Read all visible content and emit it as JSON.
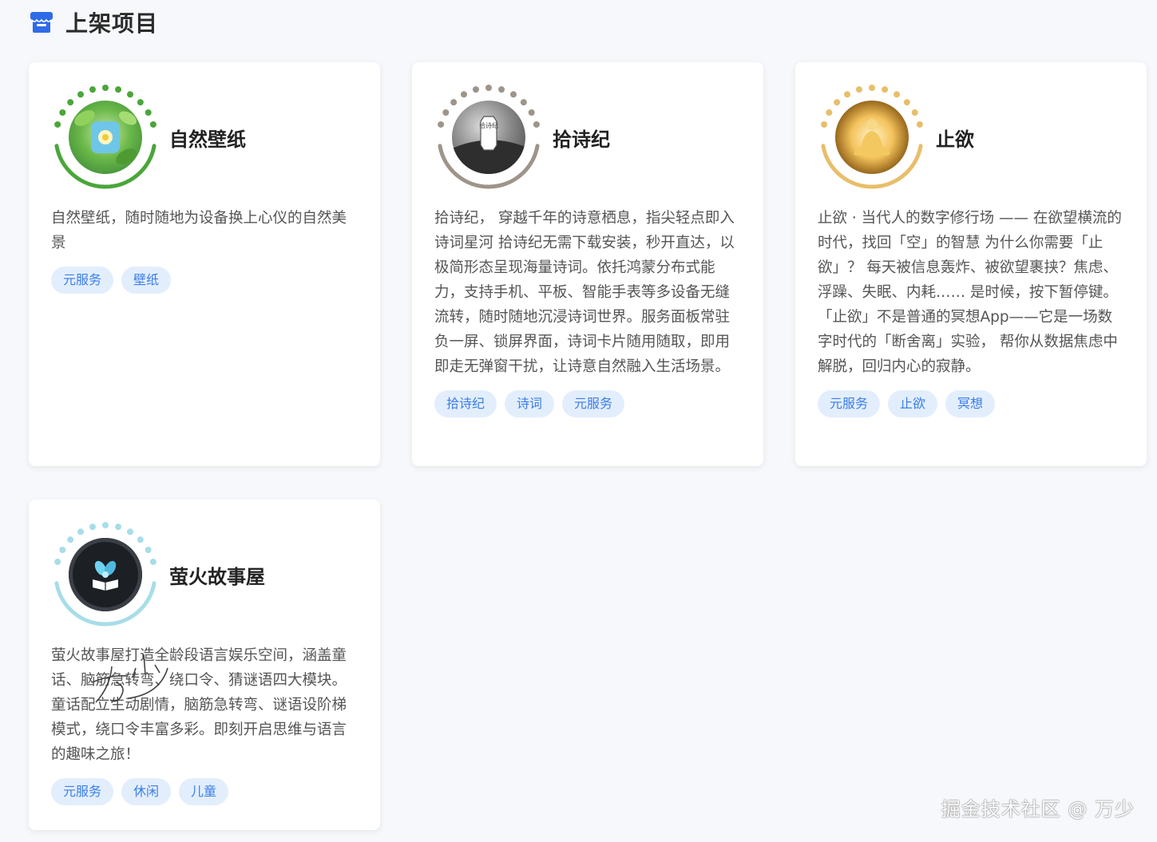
{
  "header": {
    "title": "上架项目",
    "icon": "store-icon",
    "accent": "#2f6be8"
  },
  "cards": [
    {
      "title": "自然壁纸",
      "description": "自然壁纸，随时随地为设备换上心仪的自然美景",
      "tags": [
        "元服务",
        "壁纸"
      ],
      "ring_color": "#4aa63a"
    },
    {
      "title": "拾诗纪",
      "description": "拾诗纪， 穿越千年的诗意栖息，指尖轻点即入诗词星河 拾诗纪无需下载安装，秒开直达，以极简形态呈现海量诗词。依托鸿蒙分布式能力，支持手机、平板、智能手表等多设备无缝流转，随时随地沉浸诗词世界。服务面板常驻负一屏、锁屏界面，诗词卡片随用随取，即用即走无弹窗干扰，让诗意自然融入生活场景。",
      "tags": [
        "拾诗纪",
        "诗词",
        "元服务"
      ],
      "ring_color": "#9e9489",
      "logo_text": "拾诗纪"
    },
    {
      "title": "止欲",
      "description": "止欲 · 当代人的数字修行场 —— 在欲望横流的时代，找回「空」的智慧 为什么你需要「止欲」？ 每天被信息轰炸、被欲望裹挟？焦虑、浮躁、失眠、内耗…… 是时候，按下暂停键。 「止欲」不是普通的冥想App——它是一场数字时代的「断舍离」实验， 帮你从数据焦虑中解脱，回归内心的寂静。",
      "tags": [
        "元服务",
        "止欲",
        "冥想"
      ],
      "ring_color": "#e8be6a"
    },
    {
      "title": "萤火故事屋",
      "description": "萤火故事屋打造全龄段语言娱乐空间，涵盖童话、脑筋急转弯、绕口令、猜谜语四大模块。童话配立生动剧情，脑筋急转弯、谜语设阶梯模式，绕口令丰富多彩。即刻开启思维与语言的趣味之旅！",
      "tags": [
        "元服务",
        "休闲",
        "儿童"
      ],
      "ring_color": "#a8dde8"
    }
  ],
  "watermark": "掘金技术社区 @ 万少",
  "signature": "万少"
}
